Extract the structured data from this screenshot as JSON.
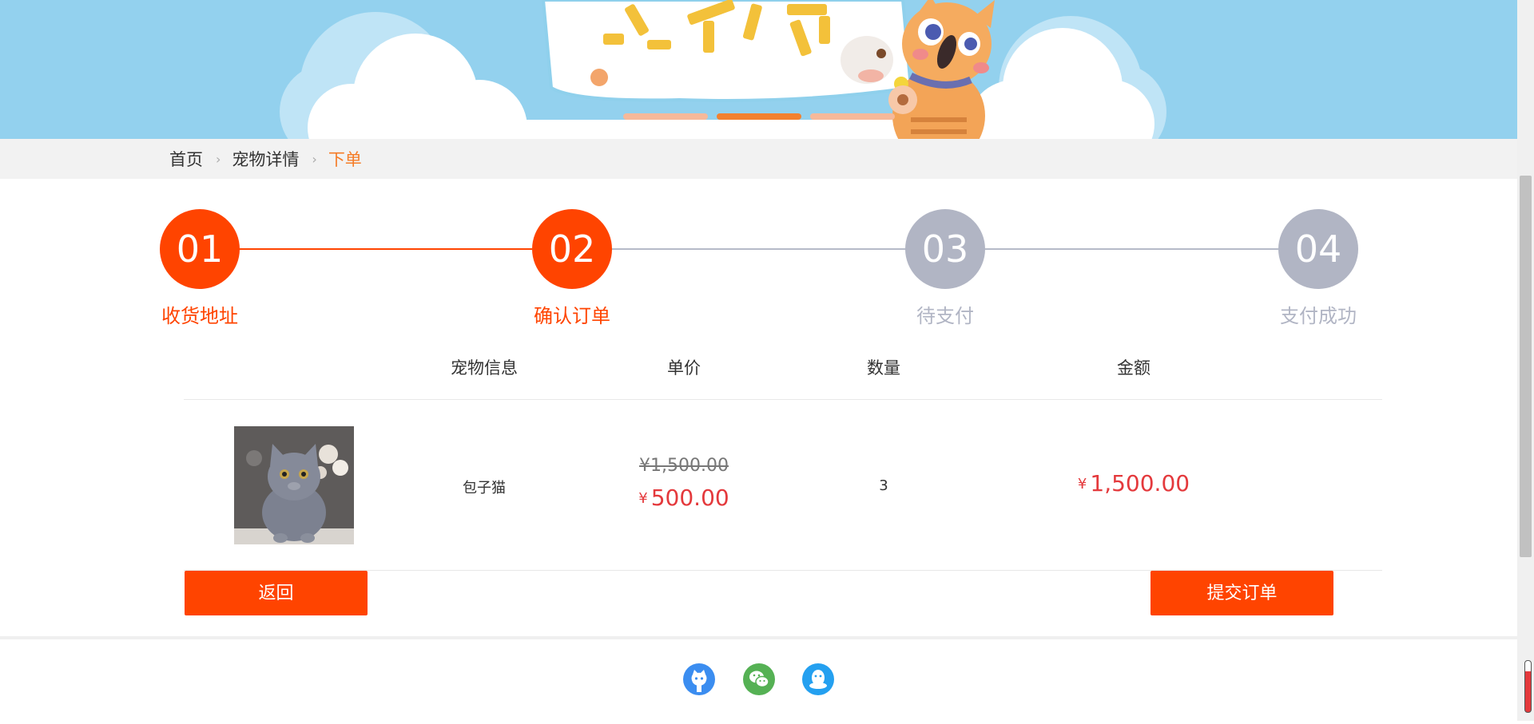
{
  "banner": {
    "carousel_count": 3,
    "active_slide": 2
  },
  "breadcrumb": {
    "items": [
      "首页",
      "宠物详情",
      "下单"
    ]
  },
  "steps": [
    {
      "number": "01",
      "label": "收货地址",
      "status": "active"
    },
    {
      "number": "02",
      "label": "确认订单",
      "status": "active"
    },
    {
      "number": "03",
      "label": "待支付",
      "status": "pending"
    },
    {
      "number": "04",
      "label": "支付成功",
      "status": "pending"
    }
  ],
  "colors": {
    "accent": "#ff4400",
    "pending": "#b1b5c4",
    "price": "#e4393c",
    "banner_sky": "#93d1ee"
  },
  "table": {
    "headers": {
      "info": "宠物信息",
      "price": "单价",
      "quantity": "数量",
      "amount": "金额"
    },
    "rows": [
      {
        "image_icon": "gray-kitten-photo",
        "name": "包子猫",
        "original_price": "¥1,500.00",
        "currency": "¥",
        "price": "500.00",
        "quantity": "3",
        "amount": "1,500.00"
      }
    ]
  },
  "buttons": {
    "back": "返回",
    "submit": "提交订单"
  },
  "footer": {
    "icons": [
      "github-icon",
      "wechat-icon",
      "qq-icon"
    ]
  }
}
